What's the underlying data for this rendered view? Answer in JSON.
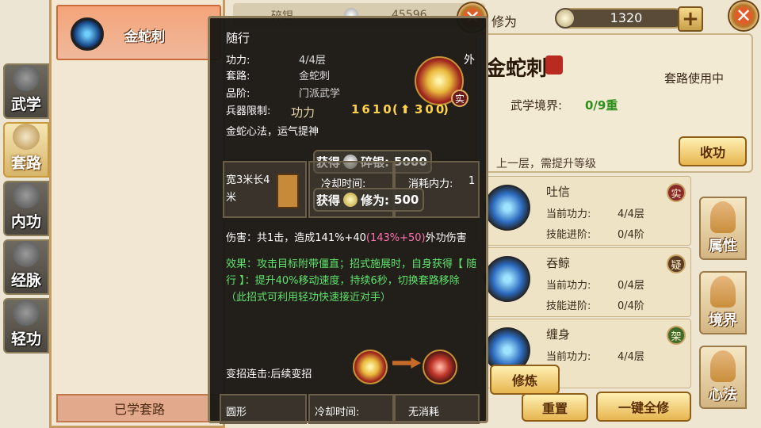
{
  "left_tabs": [
    {
      "label": "武学",
      "icon": "book-icon",
      "active": false
    },
    {
      "label": "套路",
      "icon": "scroll-icon",
      "active": true
    },
    {
      "label": "内功",
      "icon": "meditation-icon",
      "active": false
    },
    {
      "label": "经脉",
      "icon": "meridian-icon",
      "active": false
    },
    {
      "label": "轻功",
      "icon": "boot-icon",
      "active": false
    }
  ],
  "skill_list": {
    "entry_name": "金蛇刺",
    "learned_label": "已学套路"
  },
  "main": {
    "header_label": "碎银",
    "header_value": "45596",
    "cultivation_label": "修为",
    "cultivation_value": "1320",
    "detail_title": "金蛇刺",
    "route_in_use": "套路使用中",
    "realm_label": "武学境界:",
    "realm_value": "0/9重",
    "upgrade_hint": "上一层，需提升等级",
    "retract_label": "收功",
    "moves": [
      {
        "name": "吐信",
        "power_label": "当前功力:",
        "power": "4/4层",
        "progress_label": "技能进阶:",
        "progress": "0/4阶",
        "tag": "实"
      },
      {
        "name": "吞鲸",
        "power_label": "当前功力:",
        "power": "0/4层",
        "progress_label": "技能进阶:",
        "progress": "0/4阶",
        "tag": "疑"
      },
      {
        "name": "缠身",
        "power_label": "当前功力:",
        "power": "4/4层",
        "progress_label": "",
        "progress": "",
        "tag": "架"
      }
    ],
    "cultivate_label": "修炼",
    "reset_label": "重置",
    "all_cultivate_label": "一键全修",
    "right_tabs": [
      "属性",
      "境界",
      "心法"
    ]
  },
  "popup": {
    "title": "随行",
    "rows": [
      {
        "k": "功力:",
        "v": "4/4层"
      },
      {
        "k": "套路:",
        "v": "金蛇刺"
      },
      {
        "k": "品阶:",
        "v": "门派武学"
      },
      {
        "k": "兵器限制:",
        "v": ""
      }
    ],
    "mind": "金蛇心法，运气提神",
    "outer_tag": "外",
    "real_tag": "实",
    "power_label": "功力",
    "power_value": "1610",
    "power_gain": "300",
    "gain_silver_label": "获得",
    "gain_silver_name": "碎银:",
    "gain_silver": "5000",
    "gain_cult_label": "获得",
    "gain_cult_name": "修为:",
    "gain_cult": "500",
    "range_text": "宽3米长4米",
    "cooldown_label": "冷却时间:",
    "cost_label": "消耗内力:",
    "cost_value": "1",
    "damage_prefix": "伤害：共1击，造成141%+40",
    "damage_highlight": "(143%+50)",
    "damage_suffix": "外功伤害",
    "effect": "效果：攻击目标附带僵直；招式施展时，自身获得【 随行 】：提升40%移动速度，持续6秒，切换套路移除（此招式可利用轻功快速接近对手）",
    "combo_label": "变招连击:后续变招",
    "bottom_shape": "圆形",
    "bottom_cooldown": "冷却时间:",
    "bottom_cost": "无消耗"
  }
}
